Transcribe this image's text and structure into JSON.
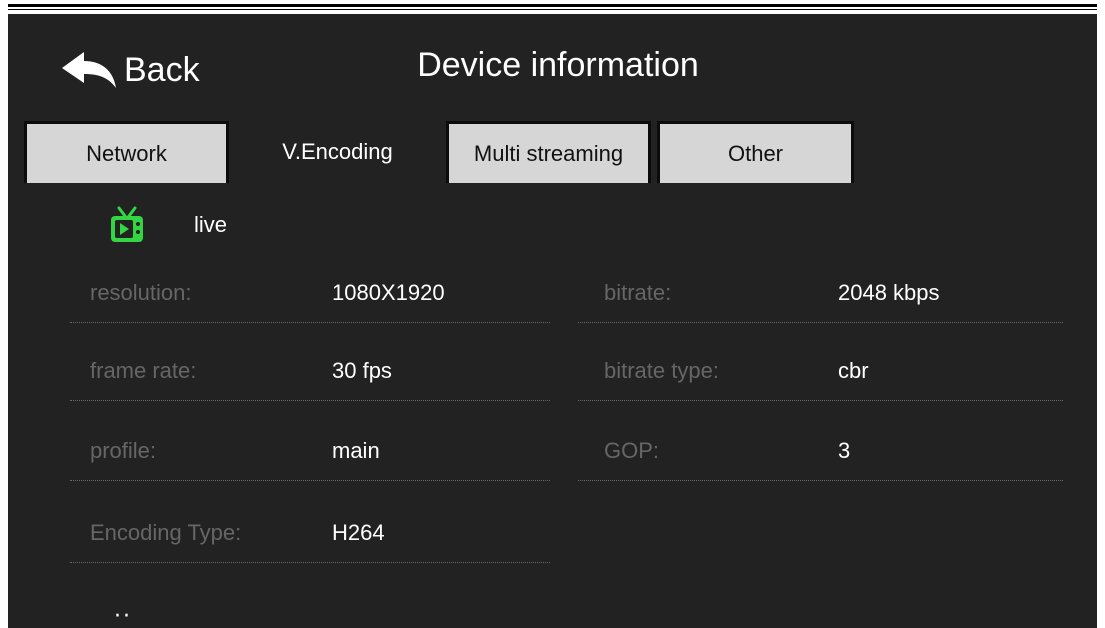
{
  "header": {
    "back_label": "Back",
    "title": "Device information"
  },
  "tabs": [
    {
      "label": "Network",
      "active": false
    },
    {
      "label": "V.Encoding",
      "active": true
    },
    {
      "label": "Multi streaming",
      "active": false
    },
    {
      "label": "Other",
      "active": false
    }
  ],
  "stream": {
    "name": "live",
    "icon": "tv-icon",
    "icon_color": "#33d642"
  },
  "fields": {
    "resolution": {
      "label": "resolution:",
      "value": "1080X1920"
    },
    "bitrate": {
      "label": "bitrate:",
      "value": "2048 kbps"
    },
    "frame_rate": {
      "label": "frame rate:",
      "value": "30 fps"
    },
    "bitrate_type": {
      "label": "bitrate type:",
      "value": "cbr"
    },
    "profile": {
      "label": "profile:",
      "value": "main"
    },
    "gop": {
      "label": "GOP:",
      "value": "3"
    },
    "encoding_type": {
      "label": "Encoding Type:",
      "value": "H264"
    }
  },
  "more_indicator": "··"
}
